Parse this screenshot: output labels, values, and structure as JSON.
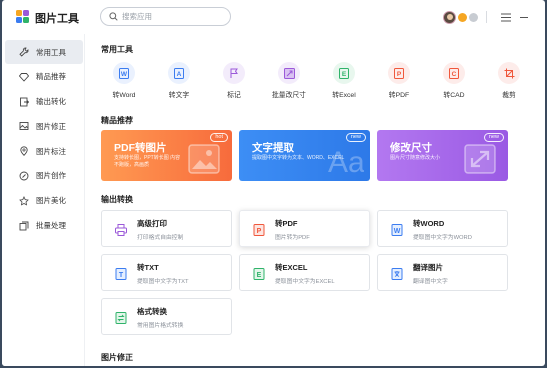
{
  "app": {
    "title": "图片工具"
  },
  "search": {
    "placeholder": "搜索应用"
  },
  "header_icons": [
    "avatar",
    "vip-badge",
    "status-badge",
    "menu-icon",
    "minimize-icon"
  ],
  "sidebar": {
    "items": [
      {
        "label": "常用工具",
        "icon": "wrench-icon",
        "active": true
      },
      {
        "label": "精品推荐",
        "icon": "gem-icon",
        "active": false
      },
      {
        "label": "输出转化",
        "icon": "export-icon",
        "active": false
      },
      {
        "label": "图片修正",
        "icon": "image-edit-icon",
        "active": false
      },
      {
        "label": "图片标注",
        "icon": "pin-icon",
        "active": false
      },
      {
        "label": "图片创作",
        "icon": "brush-icon",
        "active": false
      },
      {
        "label": "图片美化",
        "icon": "palette-icon",
        "active": false
      },
      {
        "label": "批量处理",
        "icon": "batch-icon",
        "active": false
      }
    ]
  },
  "sections": {
    "common": "常用工具",
    "featured": "精品推荐",
    "output": "输出转换",
    "fix": "图片修正"
  },
  "common_tools": [
    {
      "label": "转Word",
      "color": "#3b7cf0",
      "bg": "#eaf1fe",
      "glyph": "W"
    },
    {
      "label": "转文字",
      "color": "#3b7cf0",
      "bg": "#eaf1fe",
      "glyph": "A"
    },
    {
      "label": "标记",
      "color": "#9b59d9",
      "bg": "#f3ecfb",
      "glyph": "⚑"
    },
    {
      "label": "批量改尺寸",
      "color": "#9b59d9",
      "bg": "#f3ecfb",
      "glyph": "▣"
    },
    {
      "label": "转Excel",
      "color": "#2fb36a",
      "bg": "#e8f7ee",
      "glyph": "E"
    },
    {
      "label": "转PDF",
      "color": "#f0573b",
      "bg": "#fdecea",
      "glyph": "P"
    },
    {
      "label": "转CAD",
      "color": "#f0573b",
      "bg": "#fdecea",
      "glyph": "C"
    },
    {
      "label": "裁剪",
      "color": "#f0573b",
      "bg": "#fdecea",
      "glyph": "⟀"
    }
  ],
  "featured": [
    {
      "title": "PDF转图片",
      "desc": "支持转长图，PPT转长图 内容不跑版，高画质",
      "tag": "hot",
      "color1": "#ff9a52",
      "color2": "#f76b3c"
    },
    {
      "title": "文字提取",
      "desc": "提取图中文字转为文本、WORD、EXCEL",
      "tag": "new",
      "color1": "#3d8ef5",
      "color2": "#2d79e8"
    },
    {
      "title": "修改尺寸",
      "desc": "图片尺寸随意修改大小",
      "tag": "new",
      "color1": "#b378f0",
      "color2": "#9a5ae4"
    }
  ],
  "output": [
    {
      "name": "高级打印",
      "desc": "打印格式自由控制",
      "color": "#9b59d9",
      "glyph": "⎙"
    },
    {
      "name": "转PDF",
      "desc": "图片转为PDF",
      "color": "#f0573b",
      "glyph": "P"
    },
    {
      "name": "转WORD",
      "desc": "提取图中文字为WORD",
      "color": "#3b7cf0",
      "glyph": "W"
    },
    {
      "name": "转TXT",
      "desc": "提取图中文字为TXT",
      "color": "#3b7cf0",
      "glyph": "T"
    },
    {
      "name": "转EXCEL",
      "desc": "提取图中文字为EXCEL",
      "color": "#2fb36a",
      "glyph": "E"
    },
    {
      "name": "翻译图片",
      "desc": "翻译图中文字",
      "color": "#3b7cf0",
      "glyph": "文"
    },
    {
      "name": "格式转换",
      "desc": "常用图片格式转换",
      "color": "#2fb36a",
      "glyph": "⇄"
    }
  ]
}
